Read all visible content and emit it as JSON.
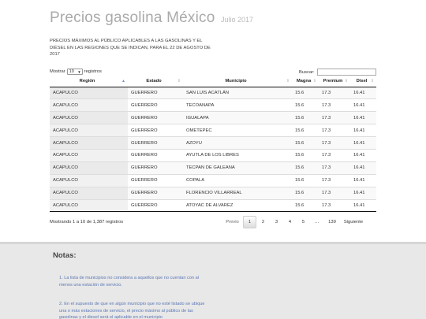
{
  "header": {
    "title": "Precios gasolina México",
    "subtitle": "Julio 2017"
  },
  "intro": "PRECIOS MÁXIMOS AL PÚBLICO APLICABLES A LAS GASOLINAS Y EL DIÉSEL EN LAS REGIONES QUE SE INDICAN, PARA EL 22 DE AGOSTO DE 2017",
  "controls": {
    "show_label": "Mostrar",
    "page_length": "10",
    "records_label": "registros",
    "search_label": "Buscar:",
    "search_value": ""
  },
  "table": {
    "columns": [
      "Región",
      "Estado",
      "Municipio",
      "Magna",
      "Premium",
      "Disel"
    ],
    "rows": [
      [
        "ACAPULCO",
        "GUERRERO",
        "SAN LUIS ACATLÁN",
        "15.6",
        "17.3",
        "16.41"
      ],
      [
        "ACAPULCO",
        "GUERRERO",
        "TECOANAPA",
        "15.6",
        "17.3",
        "16.41"
      ],
      [
        "ACAPULCO",
        "GUERRERO",
        "IGUALAPA",
        "15.6",
        "17.3",
        "16.41"
      ],
      [
        "ACAPULCO",
        "GUERRERO",
        "OMETEPEC",
        "15.6",
        "17.3",
        "16.41"
      ],
      [
        "ACAPULCO",
        "GUERRERO",
        "AZOYU",
        "15.6",
        "17.3",
        "16.41"
      ],
      [
        "ACAPULCO",
        "GUERRERO",
        "AYUTLA DE LOS LIBRES",
        "15.6",
        "17.3",
        "16.41"
      ],
      [
        "ACAPULCO",
        "GUERRERO",
        "TECPAN DE GALEANA",
        "15.6",
        "17.3",
        "16.41"
      ],
      [
        "ACAPULCO",
        "GUERRERO",
        "COPALA",
        "15.6",
        "17.3",
        "16.41"
      ],
      [
        "ACAPULCO",
        "GUERRERO",
        "FLORENCIO VILLARREAL",
        "15.6",
        "17.3",
        "16.41"
      ],
      [
        "ACAPULCO",
        "GUERRERO",
        "ATOYAC DE ALVAREZ",
        "15.6",
        "17.3",
        "16.41"
      ]
    ]
  },
  "info": "Mostrando 1 a 10 de 1,387 registros",
  "pagination": {
    "prev": "Previo",
    "pages": [
      "1",
      "2",
      "3",
      "4",
      "5"
    ],
    "current": "1",
    "ellipsis": "…",
    "last": "139",
    "next": "Siguiente"
  },
  "notes": {
    "title": "Notas:",
    "items": [
      "1. La lista de municipios no considera a aquellos que no cuentan con al menos una estación de servicio.",
      "2. En el supuesto de que en algún municipio que no esté listado se ubique una o más estaciones de servicio, el precio máximo al público de las gasolinas y el diesel será el aplicable en el municipio"
    ]
  },
  "colors": {
    "title": "#aaaaaa",
    "notes_bg": "#e8e8e8",
    "notes_text": "#5a77b5",
    "sort_active": "#6b8fd0"
  }
}
